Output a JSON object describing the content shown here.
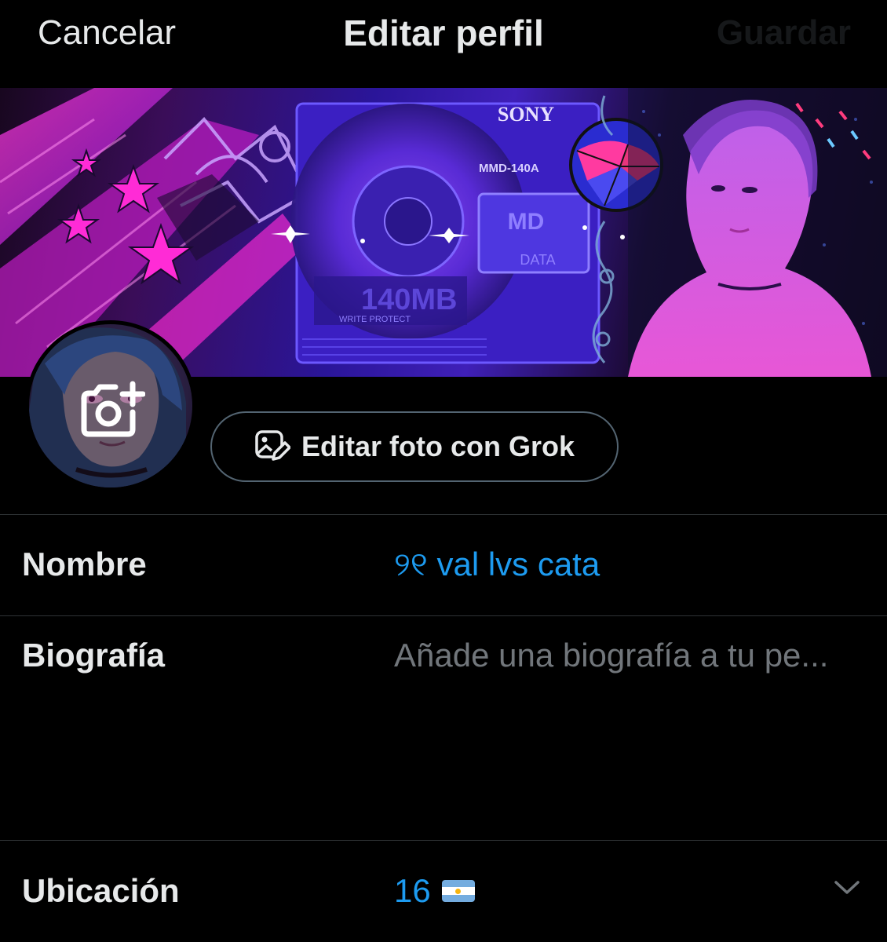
{
  "header": {
    "cancel_label": "Cancelar",
    "title": "Editar perfil",
    "save_label": "Guardar"
  },
  "banner": {
    "brand_text": "SONY",
    "model_text": "MMD-140A",
    "capacity_text": "140MB",
    "protect_text": "WRITE PROTECT",
    "data_text": "DATA",
    "md_text": "MD"
  },
  "grok_button": {
    "label": "Editar foto con Grok",
    "icon": "image-edit-icon"
  },
  "fields": {
    "name": {
      "label": "Nombre",
      "value": "୨୧ val lvs cata"
    },
    "bio": {
      "label": "Biografía",
      "placeholder": "Añade una biografía a tu pe..."
    },
    "location": {
      "label": "Ubicación",
      "value": "16",
      "flag": "argentina-flag-icon",
      "icon": "chevron-down-icon"
    }
  },
  "colors": {
    "background": "#000000",
    "accent": "#1d9bf0",
    "text_primary": "#e7e9ea",
    "text_secondary": "#71767b",
    "divider": "#2f3336",
    "banner_pink": "#ff2bd6",
    "banner_blue": "#3a2bd8"
  }
}
